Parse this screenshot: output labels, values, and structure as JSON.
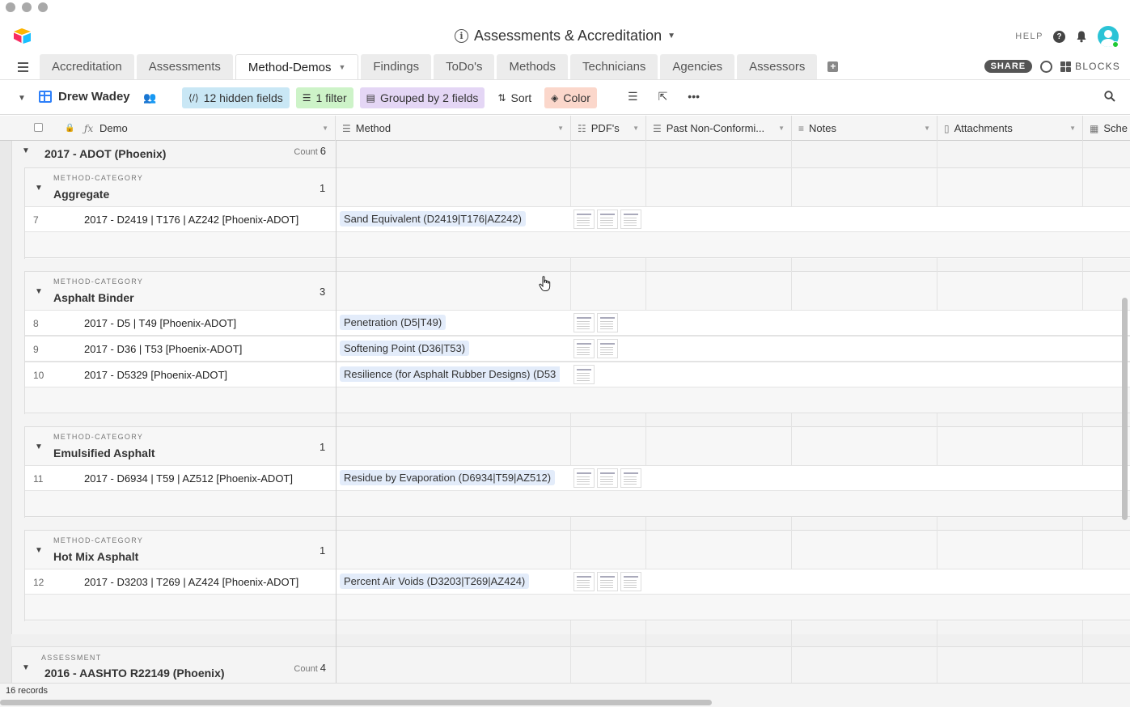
{
  "window": {
    "title": "Assessments & Accreditation"
  },
  "header": {
    "help_label": "HELP",
    "share_label": "SHARE",
    "blocks_label": "BLOCKS"
  },
  "tabs": [
    {
      "label": "Accreditation"
    },
    {
      "label": "Assessments"
    },
    {
      "label": "Method-Demos",
      "active": true
    },
    {
      "label": "Findings"
    },
    {
      "label": "ToDo's"
    },
    {
      "label": "Methods"
    },
    {
      "label": "Technicians"
    },
    {
      "label": "Agencies"
    },
    {
      "label": "Assessors"
    }
  ],
  "viewbar": {
    "view_name": "Drew Wadey",
    "hidden_fields": "12 hidden fields",
    "filter": "1 filter",
    "grouped": "Grouped by 2 fields",
    "sort": "Sort",
    "color": "Color"
  },
  "columns": [
    {
      "label": "Demo",
      "icon": "formula-icon"
    },
    {
      "label": "Method",
      "icon": "link-icon"
    },
    {
      "label": "PDF's",
      "icon": "lookup-icon"
    },
    {
      "label": "Past Non-Conformi...",
      "icon": "link-icon"
    },
    {
      "label": "Notes",
      "icon": "long-text-icon"
    },
    {
      "label": "Attachments",
      "icon": "attachment-icon"
    },
    {
      "label": "Sche",
      "icon": "calendar-icon"
    }
  ],
  "groups": {
    "assessment_label": "ASSESSMENT",
    "category_label": "METHOD-CATEGORY",
    "count_label": "Count",
    "assessment1": {
      "title": "2017 - ADOT (Phoenix)",
      "count": "6"
    },
    "assessment2": {
      "title": "2016 - AASHTO R22149 (Phoenix)",
      "count": "4"
    },
    "categories": [
      {
        "title": "Aggregate",
        "count": "1",
        "rows": [
          {
            "num": "7",
            "demo": "2017 - D2419 | T176 | AZ242 [Phoenix-ADOT]",
            "method": "Sand Equivalent (D2419|T176|AZ242)",
            "pdfs": 3
          }
        ]
      },
      {
        "title": "Asphalt Binder",
        "count": "3",
        "rows": [
          {
            "num": "8",
            "demo": "2017 - D5 | T49 [Phoenix-ADOT]",
            "method": "Penetration (D5|T49)",
            "pdfs": 2
          },
          {
            "num": "9",
            "demo": "2017 - D36 | T53 [Phoenix-ADOT]",
            "method": "Softening Point (D36|T53)",
            "pdfs": 2
          },
          {
            "num": "10",
            "demo": "2017 - D5329 [Phoenix-ADOT]",
            "method": "Resilience (for Asphalt Rubber Designs) (D53",
            "pdfs": 1
          }
        ]
      },
      {
        "title": "Emulsified Asphalt",
        "count": "1",
        "rows": [
          {
            "num": "11",
            "demo": "2017 - D6934 | T59 | AZ512 [Phoenix-ADOT]",
            "method": "Residue by Evaporation (D6934|T59|AZ512)",
            "pdfs": 3
          }
        ]
      },
      {
        "title": "Hot Mix Asphalt",
        "count": "1",
        "rows": [
          {
            "num": "12",
            "demo": "2017 - D3203 | T269 | AZ424 [Phoenix-ADOT]",
            "method": "Percent Air Voids (D3203|T269|AZ424)",
            "pdfs": 3
          }
        ]
      }
    ]
  },
  "footer": {
    "records": "16 records"
  },
  "colors": {
    "accent": "#2d7ff9",
    "hidden_fields_bg": "#c9e7f5",
    "filter_bg": "#cdf3c8",
    "grouped_bg": "#e4d6f5",
    "color_bg": "#fbd7cb"
  }
}
